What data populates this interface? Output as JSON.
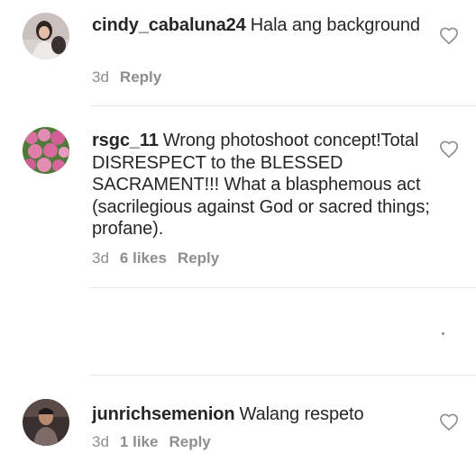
{
  "comments": [
    {
      "username": "cindy_cabaluna24",
      "text": "Hala ang background",
      "time": "3d",
      "likes": "",
      "reply": "Reply"
    },
    {
      "username": "rsgc_11",
      "text": "Wrong photoshoot concept!Total DISRESPECT to the BLESSED SACRAMENT!!! What a blasphemous act (sacrilegious against God or sacred things; profane).",
      "time": "3d",
      "likes": "6 likes",
      "reply": "Reply"
    },
    {
      "username": "junrichsemenion",
      "text": "Walang respeto",
      "time": "3d",
      "likes": "1 like",
      "reply": "Reply"
    }
  ],
  "colors": {
    "text": "#262626",
    "secondary": "#8e8e8e",
    "divider": "#e6e6e6"
  },
  "icons": {
    "like": "heart-outline-icon"
  }
}
